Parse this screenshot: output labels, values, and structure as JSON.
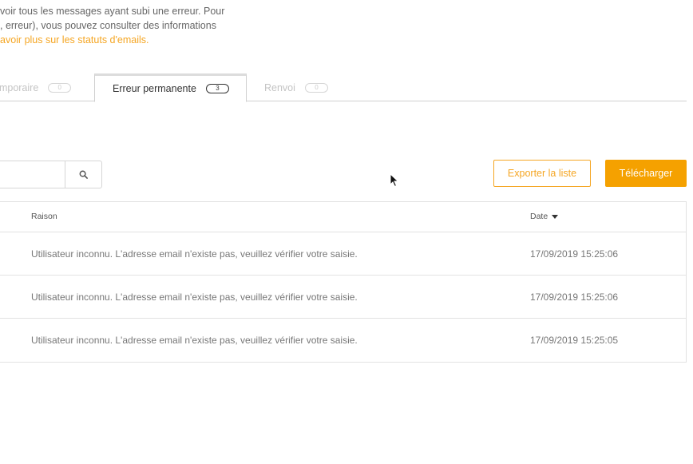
{
  "intro": {
    "line1": "voir tous les messages ayant subi une erreur. Pour",
    "line2": ", erreur), vous pouvez consulter des informations",
    "link": "avoir plus sur les statuts d'emails."
  },
  "tabs": [
    {
      "label": "emporaire",
      "count": "0"
    },
    {
      "label": "Erreur permanente",
      "count": "3"
    },
    {
      "label": "Renvoi",
      "count": "0"
    }
  ],
  "search": {
    "value": "",
    "placeholder": ""
  },
  "buttons": {
    "export": "Exporter la liste",
    "download": "Télécharger"
  },
  "table": {
    "headers": {
      "reason": "Raison",
      "date": "Date"
    },
    "rows": [
      {
        "reason": "Utilisateur inconnu. L'adresse email n'existe pas, veuillez vérifier votre saisie.",
        "date": "17/09/2019 15:25:06"
      },
      {
        "reason": "Utilisateur inconnu. L'adresse email n'existe pas, veuillez vérifier votre saisie.",
        "date": "17/09/2019 15:25:06"
      },
      {
        "reason": "Utilisateur inconnu. L'adresse email n'existe pas, veuillez vérifier votre saisie.",
        "date": "17/09/2019 15:25:05"
      }
    ]
  },
  "colors": {
    "accent": "#f5a100",
    "border": "#e2e2e2"
  }
}
